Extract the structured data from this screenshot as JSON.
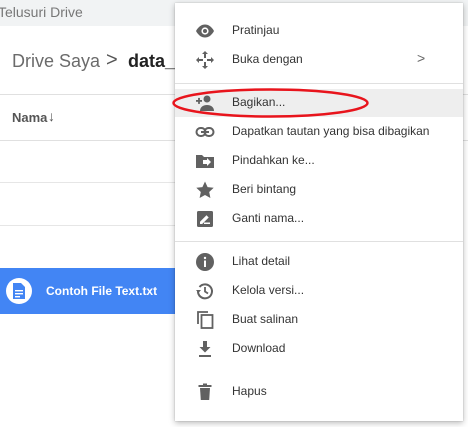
{
  "topbar": {
    "title": "Telusuri Drive"
  },
  "breadcrumb": {
    "root": "Drive Saya",
    "separator": ">",
    "current": "data_b"
  },
  "file_list": {
    "column_name": "Nama",
    "sort_icon": "arrow-down-icon",
    "selected_file": "Contoh File Text.txt",
    "selected_color": "#4285f4"
  },
  "menu": {
    "items": [
      {
        "label": "Pratinjau",
        "icon": "eye-icon"
      },
      {
        "label": "Buka dengan",
        "icon": "open-with-icon",
        "submenu": ">"
      },
      {
        "label": "Bagikan...",
        "icon": "share-person-icon"
      },
      {
        "label": "Dapatkan tautan yang bisa dibagikan",
        "icon": "link-icon"
      },
      {
        "label": "Pindahkan ke...",
        "icon": "move-folder-icon"
      },
      {
        "label": "Beri bintang",
        "icon": "star-icon"
      },
      {
        "label": "Ganti nama...",
        "icon": "rename-icon"
      },
      {
        "label": "Lihat detail",
        "icon": "info-icon"
      },
      {
        "label": "Kelola versi...",
        "icon": "history-icon"
      },
      {
        "label": "Buat salinan",
        "icon": "copy-icon"
      },
      {
        "label": "Download",
        "icon": "download-icon"
      },
      {
        "label": "Hapus",
        "icon": "trash-icon"
      }
    ],
    "highlight_color": "#e8141c"
  }
}
